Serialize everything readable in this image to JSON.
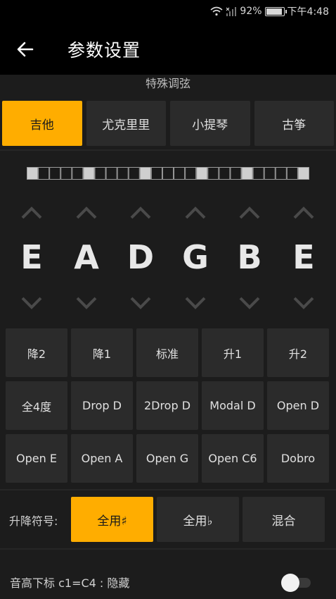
{
  "status_bar": {
    "battery": "92%",
    "time": "下午4:48"
  },
  "app_bar": {
    "title": "参数设置"
  },
  "special_tuning_label": "特殊调弦",
  "instruments": [
    {
      "label": "吉他",
      "active": true
    },
    {
      "label": "尤克里里",
      "active": false
    },
    {
      "label": "小提琴",
      "active": false
    },
    {
      "label": "古筝",
      "active": false
    }
  ],
  "fretboard": {
    "cells": 24,
    "highlighted": [
      0,
      5,
      10,
      15,
      19,
      24
    ]
  },
  "strings": [
    "E",
    "A",
    "D",
    "G",
    "B",
    "E"
  ],
  "presets": [
    "降2",
    "降1",
    "标准",
    "升1",
    "升2",
    "全4度",
    "Drop D",
    "2Drop D",
    "Modal D",
    "Open D",
    "Open E",
    "Open A",
    "Open G",
    "Open C6",
    "Dobro"
  ],
  "accidentals": {
    "label": "升降符号:",
    "options": [
      {
        "label": "全用♯",
        "active": true
      },
      {
        "label": "全用♭",
        "active": false
      },
      {
        "label": "混合",
        "active": false
      }
    ]
  },
  "pitch_subscript": {
    "label": "音高下标 c1=C4 : 隐藏",
    "enabled": false
  },
  "colors": {
    "accent": "#ffad00",
    "button": "#2b2b2b",
    "background": "#1c1c1c"
  }
}
